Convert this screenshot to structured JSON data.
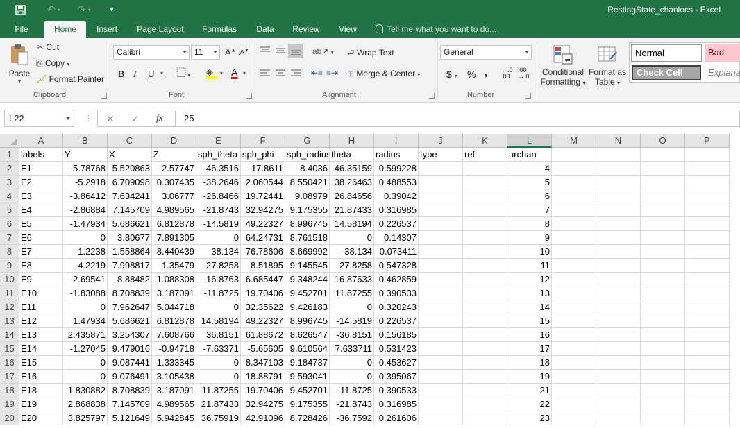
{
  "app": {
    "window_title": "RestingState_chanlocs - Excel",
    "accent": "#217346"
  },
  "quick_access": {
    "save_icon": "save-icon",
    "undo_icon": "undo-icon",
    "redo_icon": "redo-icon",
    "customize_icon": "customize-icon"
  },
  "tabs": [
    {
      "label": "File"
    },
    {
      "label": "Home"
    },
    {
      "label": "Insert"
    },
    {
      "label": "Page Layout"
    },
    {
      "label": "Formulas"
    },
    {
      "label": "Data"
    },
    {
      "label": "Review"
    },
    {
      "label": "View"
    }
  ],
  "tell_me": "Tell me what you want to do...",
  "clipboard": {
    "group_label": "Clipboard",
    "paste": "Paste",
    "cut": "Cut",
    "copy": "Copy",
    "format_painter": "Format Painter"
  },
  "font": {
    "group_label": "Font",
    "name": "Calibri",
    "size": "11",
    "bold": "B",
    "italic": "I",
    "underline": "U",
    "grow": "A",
    "shrink": "A",
    "fill_color": "#ffff00",
    "font_color": "#ff0000"
  },
  "alignment": {
    "group_label": "Alignment",
    "wrap_text": "Wrap Text",
    "merge_center": "Merge & Center"
  },
  "number": {
    "group_label": "Number",
    "format": "General",
    "currency": "$",
    "percent": "%",
    "comma": ",",
    "inc_decimal": ".00",
    "dec_decimal": ".00"
  },
  "styles": {
    "conditional_formatting_1": "Conditional",
    "conditional_formatting_2": "Formatting",
    "format_as_table_1": "Format as",
    "format_as_table_2": "Table",
    "normal": "Normal",
    "bad": "Bad",
    "check_cell": "Check Cell",
    "explanatory": "Explanatory"
  },
  "formula_bar": {
    "name_box": "L22",
    "cancel": "✕",
    "enter": "✓",
    "fx": "fx",
    "value": "25"
  },
  "sheet": {
    "columns": [
      "A",
      "B",
      "C",
      "D",
      "E",
      "F",
      "G",
      "H",
      "I",
      "J",
      "K",
      "L",
      "M",
      "N",
      "O",
      "P"
    ],
    "selected_column": "L",
    "rows": [
      {
        "n": "1",
        "cells": [
          "labels",
          "Y",
          "X",
          "Z",
          "sph_theta",
          "sph_phi",
          "sph_radius",
          "theta",
          "radius",
          "type",
          "ref",
          "urchan"
        ]
      },
      {
        "n": "2",
        "cells": [
          "E1",
          "-5.78768",
          "5.520863",
          "-2.57747",
          "-46.3516",
          "-17.8611",
          "8.4036",
          "46.35159",
          "0.599228",
          "",
          "",
          "4"
        ]
      },
      {
        "n": "3",
        "cells": [
          "E2",
          "-5.2918",
          "6.709098",
          "0.307435",
          "-38.2646",
          "2.060544",
          "8.550421",
          "38.26463",
          "0.488553",
          "",
          "",
          "5"
        ]
      },
      {
        "n": "4",
        "cells": [
          "E3",
          "-3.86412",
          "7.634241",
          "3.06777",
          "-26.8466",
          "19.72441",
          "9.08979",
          "26.84656",
          "0.39042",
          "",
          "",
          "6"
        ]
      },
      {
        "n": "5",
        "cells": [
          "E4",
          "-2.86884",
          "7.145709",
          "4.989565",
          "-21.8743",
          "32.94275",
          "9.175355",
          "21.87433",
          "0.316985",
          "",
          "",
          "7"
        ]
      },
      {
        "n": "6",
        "cells": [
          "E5",
          "-1.47934",
          "5.686621",
          "6.812878",
          "-14.5819",
          "49.22327",
          "8.996745",
          "14.58194",
          "0.226537",
          "",
          "",
          "8"
        ]
      },
      {
        "n": "7",
        "cells": [
          "E6",
          "0",
          "3.80677",
          "7.891305",
          "0",
          "64.24731",
          "8.761518",
          "0",
          "0.14307",
          "",
          "",
          "9"
        ]
      },
      {
        "n": "8",
        "cells": [
          "E7",
          "1.2238",
          "1.558864",
          "8.440439",
          "38.134",
          "76.78606",
          "8.669992",
          "-38.134",
          "0.073411",
          "",
          "",
          "10"
        ]
      },
      {
        "n": "9",
        "cells": [
          "E8",
          "-4.2219",
          "7.998817",
          "-1.35479",
          "-27.8258",
          "-8.51895",
          "9.145545",
          "27.8258",
          "0.547328",
          "",
          "",
          "11"
        ]
      },
      {
        "n": "10",
        "cells": [
          "E9",
          "-2.69541",
          "8.88482",
          "1.088308",
          "-16.8763",
          "6.685447",
          "9.348244",
          "16.87633",
          "0.462859",
          "",
          "",
          "12"
        ]
      },
      {
        "n": "11",
        "cells": [
          "E10",
          "-1.83088",
          "8.708839",
          "3.187091",
          "-11.8725",
          "19.70406",
          "9.452701",
          "11.87255",
          "0.390533",
          "",
          "",
          "13"
        ]
      },
      {
        "n": "12",
        "cells": [
          "E11",
          "0",
          "7.962647",
          "5.044718",
          "0",
          "32.35622",
          "9.426183",
          "0",
          "0.320243",
          "",
          "",
          "14"
        ]
      },
      {
        "n": "13",
        "cells": [
          "E12",
          "1.47934",
          "5.686621",
          "6.812878",
          "14.58194",
          "49.22327",
          "8.996745",
          "-14.5819",
          "0.226537",
          "",
          "",
          "15"
        ]
      },
      {
        "n": "14",
        "cells": [
          "E13",
          "2.435871",
          "3.254307",
          "7.608766",
          "36.8151",
          "61.88672",
          "8.626547",
          "-36.8151",
          "0.156185",
          "",
          "",
          "16"
        ]
      },
      {
        "n": "15",
        "cells": [
          "E14",
          "-1.27045",
          "9.479016",
          "-0.94718",
          "-7.63371",
          "-5.65605",
          "9.610564",
          "7.633711",
          "0.531423",
          "",
          "",
          "17"
        ]
      },
      {
        "n": "16",
        "cells": [
          "E15",
          "0",
          "9.087441",
          "1.333345",
          "0",
          "8.347103",
          "9.184737",
          "0",
          "0.453627",
          "",
          "",
          "18"
        ]
      },
      {
        "n": "17",
        "cells": [
          "E16",
          "0",
          "9.076491",
          "3.105438",
          "0",
          "18.88791",
          "9.593041",
          "0",
          "0.395067",
          "",
          "",
          "19"
        ]
      },
      {
        "n": "18",
        "cells": [
          "E18",
          "1.830882",
          "8.708839",
          "3.187091",
          "11.87255",
          "19.70406",
          "9.452701",
          "-11.8725",
          "0.390533",
          "",
          "",
          "21"
        ]
      },
      {
        "n": "19",
        "cells": [
          "E19",
          "2.868838",
          "7.145709",
          "4.989565",
          "21.87433",
          "32.94275",
          "9.175355",
          "-21.8743",
          "0.316985",
          "",
          "",
          "22"
        ]
      },
      {
        "n": "20",
        "cells": [
          "E20",
          "3.825797",
          "5.121649",
          "5.942845",
          "36.75919",
          "42.91096",
          "8.728426",
          "-36.7592",
          "0.261606",
          "",
          "",
          "23"
        ]
      }
    ]
  }
}
